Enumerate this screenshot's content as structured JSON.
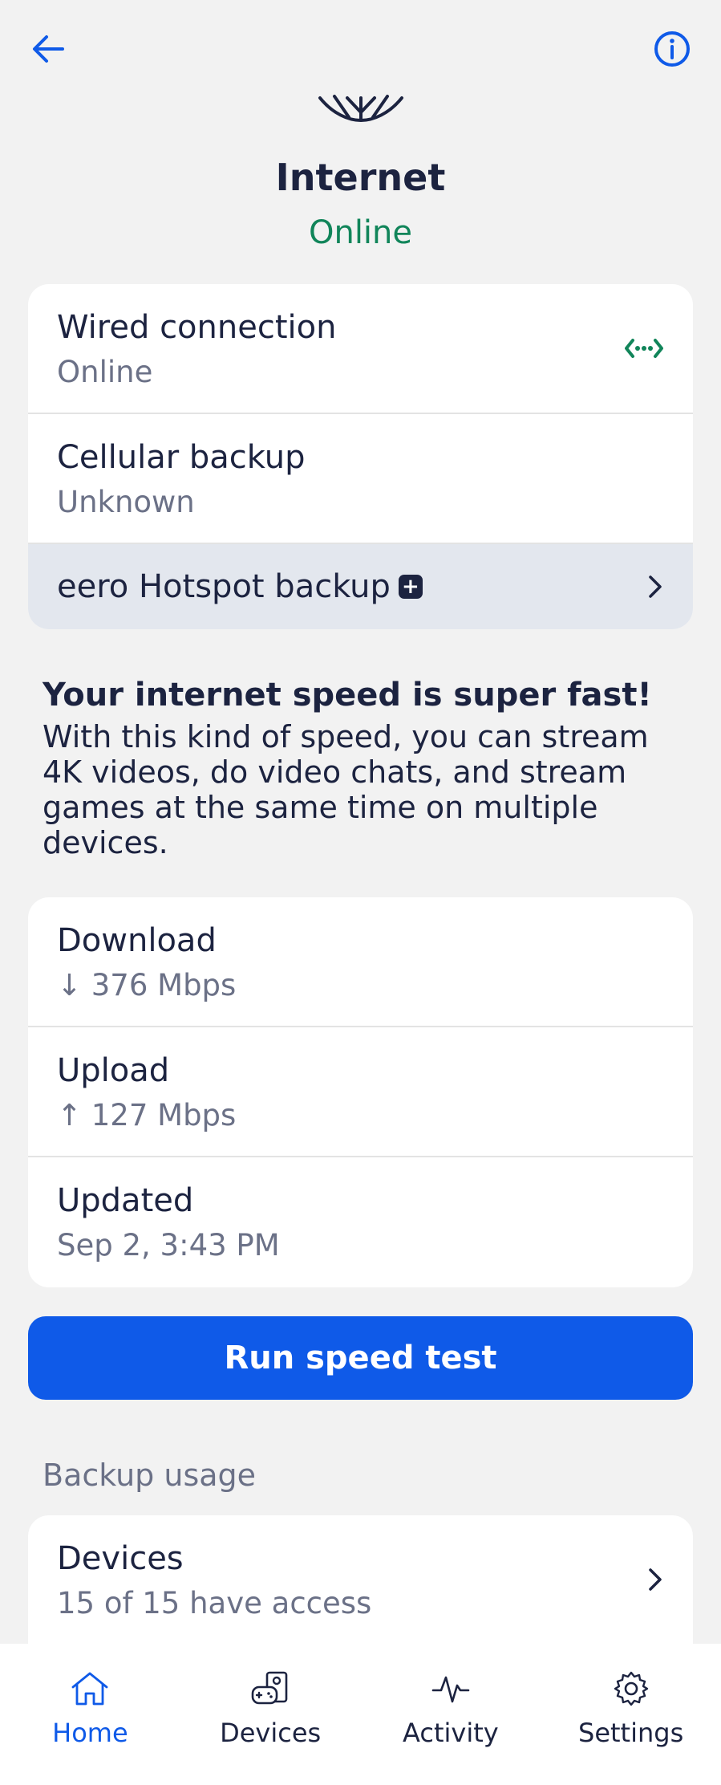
{
  "header": {
    "back_icon": "arrow-left-icon",
    "info_icon": "info-icon"
  },
  "hero": {
    "title": "Internet",
    "status": "Online",
    "status_color": "#11855a"
  },
  "connections": [
    {
      "label": "Wired connection",
      "value": "Online",
      "icon": "ethernet-icon"
    },
    {
      "label": "Cellular backup",
      "value": "Unknown"
    }
  ],
  "hotspot": {
    "label": "eero Hotspot backup",
    "badge_icon": "plus-badge-icon"
  },
  "speed_message": {
    "headline": "Your internet speed is super fast!",
    "body": "With this kind of speed, you can stream 4K videos, do video chats, and stream games at the same time on multiple devices."
  },
  "speed": {
    "download_label": "Download",
    "download_value": "↓ 376 Mbps",
    "upload_label": "Upload",
    "upload_value": "↑ 127 Mbps",
    "updated_label": "Updated",
    "updated_value": "Sep 2, 3:43 PM"
  },
  "run_button": "Run speed test",
  "backup": {
    "heading": "Backup usage",
    "devices_label": "Devices",
    "devices_value": "15 of 15 have access"
  },
  "tabs": [
    {
      "label": "Home",
      "icon": "home-icon",
      "active": true
    },
    {
      "label": "Devices",
      "icon": "devices-icon",
      "active": false
    },
    {
      "label": "Activity",
      "icon": "activity-icon",
      "active": false
    },
    {
      "label": "Settings",
      "icon": "settings-icon",
      "active": false
    }
  ],
  "colors": {
    "accent": "#0f5ae8",
    "text": "#1c2340",
    "muted": "#6b7187",
    "background": "#f2f2f2"
  }
}
